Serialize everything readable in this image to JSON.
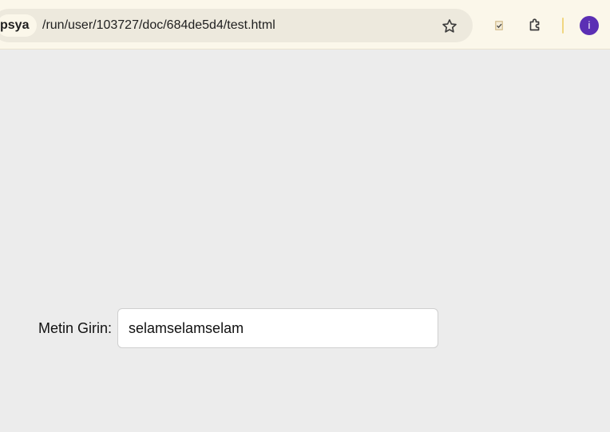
{
  "browser": {
    "site_chip": "psya",
    "url": "/run/user/103727/doc/684de5d4/test.html",
    "icons": [
      "star-icon",
      "extension-icon",
      "puzzle-icon"
    ],
    "profile_initial": "i"
  },
  "form": {
    "label": "Metin Girin:",
    "value": "selamselamselam"
  },
  "colors": {
    "toolbar_bg": "#fbf7ea",
    "page_bg": "#ececec",
    "avatar_bg": "#5b2fb4"
  }
}
